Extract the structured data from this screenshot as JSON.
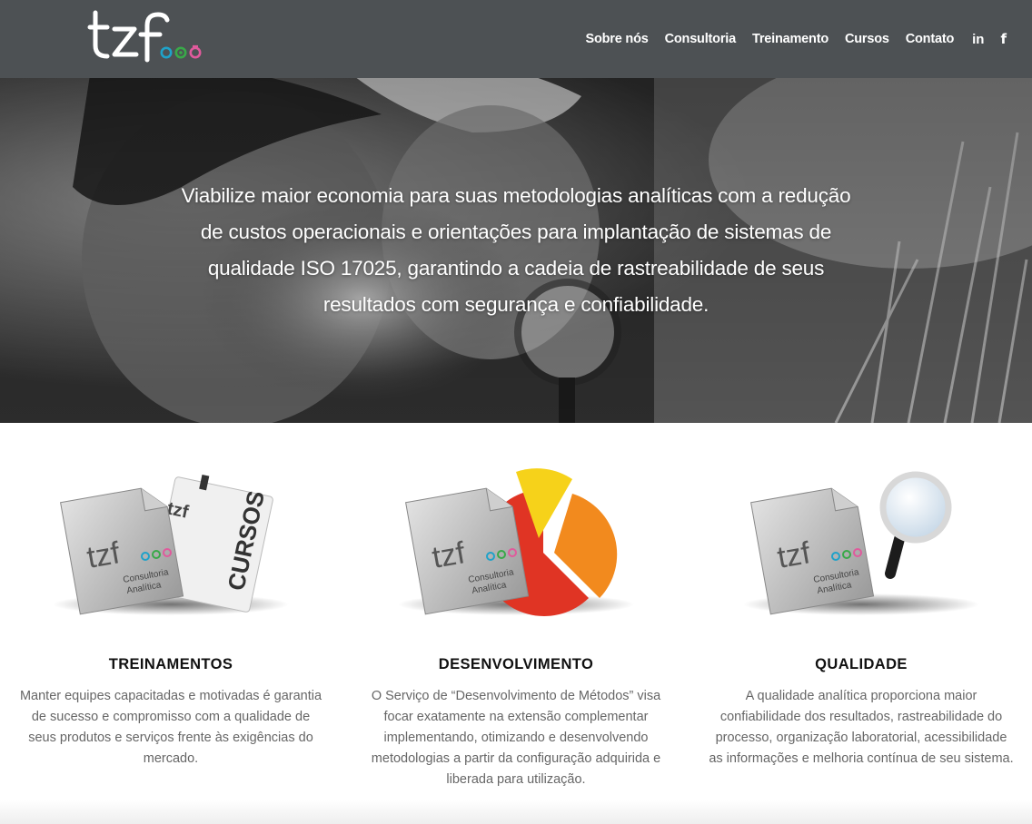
{
  "brand": {
    "logo_text": "tzf",
    "logo_colors": [
      "#1fa2c9",
      "#39a949",
      "#e05a9c"
    ]
  },
  "nav": {
    "items": [
      {
        "label": "Sobre nós"
      },
      {
        "label": "Consultoria"
      },
      {
        "label": "Treinamento"
      },
      {
        "label": "Cursos"
      },
      {
        "label": "Contato"
      }
    ],
    "social": {
      "linkedin_label": "in",
      "facebook_label": "f",
      "linkedin_icon": "linkedin-icon",
      "facebook_icon": "facebook-icon"
    }
  },
  "hero": {
    "text": "Viabilize maior economia para suas metodologias analíticas com a redução de custos operacionais e orientações para implantação de sistemas de qualidade ISO 17025, garantindo a cadeia de rastreabilidade de seus resultados com segurança e confiabilidade."
  },
  "illustration": {
    "logo_text": "tzf",
    "subtitle_line1": "Consultoria",
    "subtitle_line2": "Analítica",
    "cursos_label": "CURSOS"
  },
  "features": [
    {
      "title": "TREINAMENTOS",
      "description": "Manter equipes capacitadas e motivadas é garantia de sucesso e compromisso com a qualidade de seus produtos e serviços frente às exigências do mercado."
    },
    {
      "title": "DESENVOLVIMENTO",
      "description": "O Serviço de “Desenvolvimento de Métodos” visa focar exatamente na extensão complementar implementando, otimizando e desenvolvendo metodologias a partir da configuração adquirida e liberada para utilização."
    },
    {
      "title": "QUALIDADE",
      "description": "A qualidade analítica proporciona maior confiabilidade dos resultados, rastreabilidade do processo, organização laboratorial, acessibilidade as informações e melhoria contínua de seu sistema."
    }
  ],
  "colors": {
    "header_bg": "#4d5154",
    "title_text": "#111111",
    "body_text": "#666666",
    "chart_red": "#e03424",
    "chart_orange": "#f28a1e",
    "chart_yellow": "#f6d21a"
  }
}
